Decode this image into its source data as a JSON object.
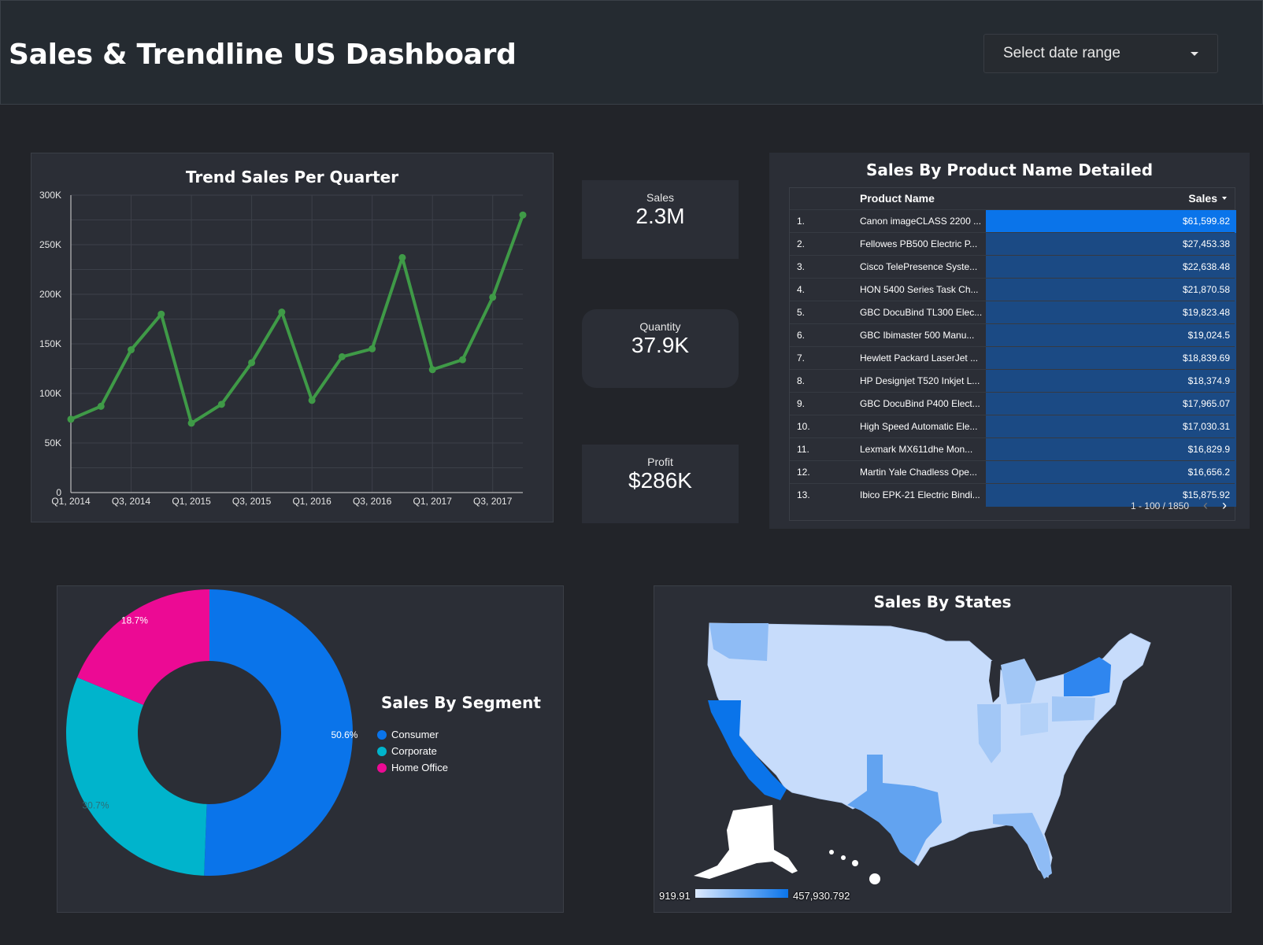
{
  "header": {
    "title": "Sales & Trendline US Dashboard",
    "date_range_label": "Select date range"
  },
  "trend": {
    "title": "Trend Sales Per Quarter",
    "chart_data": {
      "type": "line",
      "title": "Trend Sales Per Quarter",
      "x": [
        "Q1, 2014",
        "Q2, 2014",
        "Q3, 2014",
        "Q4, 2014",
        "Q1, 2015",
        "Q2, 2015",
        "Q3, 2015",
        "Q4, 2015",
        "Q1, 2016",
        "Q2, 2016",
        "Q3, 2016",
        "Q4, 2016",
        "Q1, 2017",
        "Q2, 2017",
        "Q3, 2017",
        "Q4, 2017"
      ],
      "x_tick_labels": [
        "Q1, 2014",
        "Q3, 2014",
        "Q1, 2015",
        "Q3, 2015",
        "Q1, 2016",
        "Q3, 2016",
        "Q1, 2017",
        "Q3, 2017"
      ],
      "series": [
        {
          "values": [
            74000,
            87000,
            144000,
            180000,
            70000,
            89000,
            131000,
            182000,
            93000,
            137000,
            145000,
            237000,
            124000,
            134000,
            197000,
            280000
          ],
          "color": "#3f9a47"
        }
      ],
      "ylim": [
        0,
        300000
      ],
      "y_ticks": [
        0,
        50000,
        100000,
        150000,
        200000,
        250000,
        300000
      ],
      "y_tick_labels": [
        "0",
        "50K",
        "100K",
        "150K",
        "200K",
        "250K",
        "300K"
      ],
      "grid": true,
      "xlabel": "",
      "ylabel": ""
    }
  },
  "kpis": {
    "sales": {
      "label": "Sales",
      "value": "2.3M"
    },
    "quantity": {
      "label": "Quantity",
      "value": "37.9K"
    },
    "profit": {
      "label": "Profit",
      "value": "$286K"
    }
  },
  "product_table": {
    "title": "Sales By Product Name Detailed",
    "col_product": "Product Name",
    "col_sales": "Sales",
    "max_value": 61599.82,
    "rows": [
      {
        "idx": "1.",
        "name": "Canon imageCLASS 2200 ...",
        "sales": "$61,599.82",
        "value": 61599.82
      },
      {
        "idx": "2.",
        "name": "Fellowes PB500 Electric P...",
        "sales": "$27,453.38",
        "value": 27453.38
      },
      {
        "idx": "3.",
        "name": "Cisco TelePresence Syste...",
        "sales": "$22,638.48",
        "value": 22638.48
      },
      {
        "idx": "4.",
        "name": "HON 5400 Series Task Ch...",
        "sales": "$21,870.58",
        "value": 21870.58
      },
      {
        "idx": "5.",
        "name": "GBC DocuBind TL300 Elec...",
        "sales": "$19,823.48",
        "value": 19823.48
      },
      {
        "idx": "6.",
        "name": "GBC Ibimaster 500 Manu...",
        "sales": "$19,024.5",
        "value": 19024.5
      },
      {
        "idx": "7.",
        "name": "Hewlett Packard LaserJet ...",
        "sales": "$18,839.69",
        "value": 18839.69
      },
      {
        "idx": "8.",
        "name": "HP Designjet T520 Inkjet L...",
        "sales": "$18,374.9",
        "value": 18374.9
      },
      {
        "idx": "9.",
        "name": "GBC DocuBind P400 Elect...",
        "sales": "$17,965.07",
        "value": 17965.07
      },
      {
        "idx": "10.",
        "name": "High Speed Automatic Ele...",
        "sales": "$17,030.31",
        "value": 17030.31
      },
      {
        "idx": "11.",
        "name": "Lexmark MX611dhe Mon...",
        "sales": "$16,829.9",
        "value": 16829.9
      },
      {
        "idx": "12.",
        "name": "Martin Yale Chadless Ope...",
        "sales": "$16,656.2",
        "value": 16656.2
      },
      {
        "idx": "13.",
        "name": "Ibico EPK-21 Electric Bindi...",
        "sales": "$15,875.92",
        "value": 15875.92
      }
    ],
    "pagination": "1 - 100 / 1850",
    "prev_icon": "chevron-left-icon",
    "next_icon": "chevron-right-icon",
    "sort_icon": "caret-down-icon",
    "bar_color": "#1b4a84",
    "top_bar_color": "#0a74ea"
  },
  "segment": {
    "title": "Sales By Segment",
    "chart_data": {
      "type": "pie",
      "title": "Sales By Segment",
      "labels": [
        "Consumer",
        "Corporate",
        "Home Office"
      ],
      "values": [
        50.6,
        30.7,
        18.7
      ],
      "value_labels": [
        "50.6%",
        "30.7%",
        "18.7%"
      ],
      "colors": [
        "#0a74ea",
        "#00b4cc",
        "#ec0a94"
      ],
      "donut": true,
      "legend_position": "right"
    }
  },
  "states_map": {
    "title": "Sales By States",
    "scale_min": "919.91",
    "scale_max": "457,930.792",
    "color_low": "#ddeaff",
    "color_high": "#0a74ea",
    "highlighted_states": [
      "California",
      "New York",
      "Texas",
      "Washington"
    ]
  }
}
